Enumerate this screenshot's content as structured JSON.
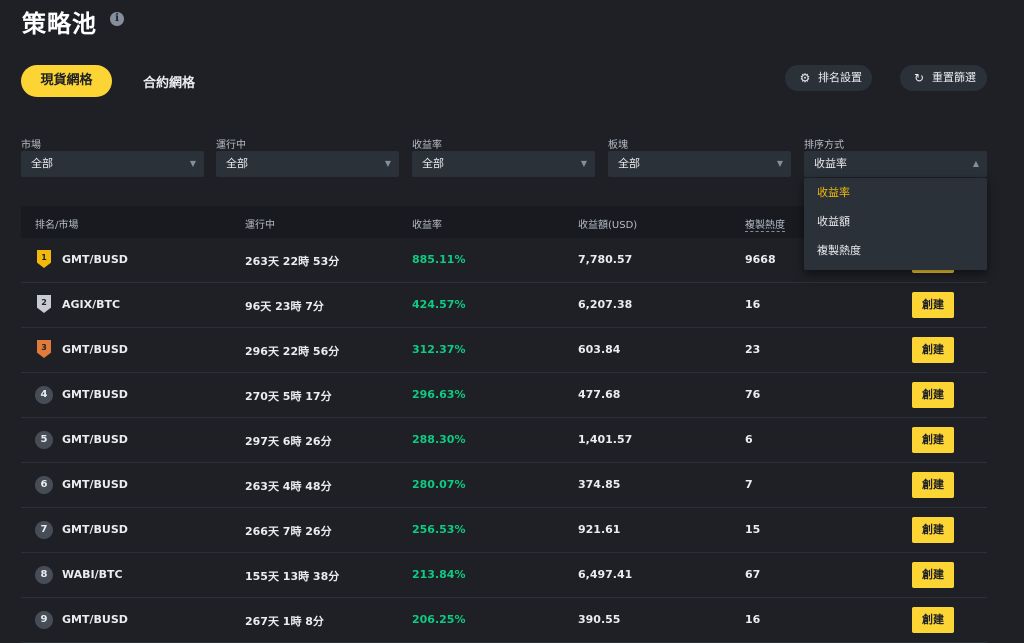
{
  "page": {
    "title": "策略池",
    "info_icon": "i"
  },
  "tabs": [
    {
      "label": "現貨網格",
      "active": true
    },
    {
      "label": "合約網格",
      "active": false
    }
  ],
  "actions": {
    "rank_settings": {
      "label": "排名設置",
      "icon": "gear-icon"
    },
    "reset_filters": {
      "label": "重置篩選",
      "icon": "refresh-icon"
    }
  },
  "filters": {
    "market": {
      "label": "市場",
      "value": "全部"
    },
    "running": {
      "label": "運行中",
      "value": "全部"
    },
    "yield": {
      "label": "收益率",
      "value": "全部"
    },
    "sector": {
      "label": "板塊",
      "value": "全部"
    },
    "sort": {
      "label": "排序方式",
      "value": "收益率"
    }
  },
  "sort_dropdown": {
    "options": [
      "收益率",
      "收益額",
      "複製熱度"
    ],
    "selected": "收益率"
  },
  "table": {
    "headers": {
      "rank_market": "排名/市場",
      "running": "運行中",
      "yield": "收益率",
      "profit": "收益額(USD)",
      "copy_heat": "複製熱度"
    },
    "create_label": "創建",
    "rows": [
      {
        "rank": "1",
        "market": "GMT/BUSD",
        "running": "263天 22時 53分",
        "yield": "885.11%",
        "profit": "7,780.57",
        "copies": "9668"
      },
      {
        "rank": "2",
        "market": "AGIX/BTC",
        "running": "96天 23時 7分",
        "yield": "424.57%",
        "profit": "6,207.38",
        "copies": "16"
      },
      {
        "rank": "3",
        "market": "GMT/BUSD",
        "running": "296天 22時 56分",
        "yield": "312.37%",
        "profit": "603.84",
        "copies": "23"
      },
      {
        "rank": "4",
        "market": "GMT/BUSD",
        "running": "270天 5時 17分",
        "yield": "296.63%",
        "profit": "477.68",
        "copies": "76"
      },
      {
        "rank": "5",
        "market": "GMT/BUSD",
        "running": "297天 6時 26分",
        "yield": "288.30%",
        "profit": "1,401.57",
        "copies": "6"
      },
      {
        "rank": "6",
        "market": "GMT/BUSD",
        "running": "263天 4時 48分",
        "yield": "280.07%",
        "profit": "374.85",
        "copies": "7"
      },
      {
        "rank": "7",
        "market": "GMT/BUSD",
        "running": "266天 7時 26分",
        "yield": "256.53%",
        "profit": "921.61",
        "copies": "15"
      },
      {
        "rank": "8",
        "market": "WABI/BTC",
        "running": "155天 13時 38分",
        "yield": "213.84%",
        "profit": "6,497.41",
        "copies": "67"
      },
      {
        "rank": "9",
        "market": "GMT/BUSD",
        "running": "267天 1時 8分",
        "yield": "206.25%",
        "profit": "390.55",
        "copies": "16"
      }
    ]
  },
  "colors": {
    "accent": "#fcd535",
    "positive": "#0ecb81",
    "background": "#1e2026",
    "gold": "#f0b90b",
    "silver": "#c8ccd2",
    "bronze": "#e07b39"
  }
}
